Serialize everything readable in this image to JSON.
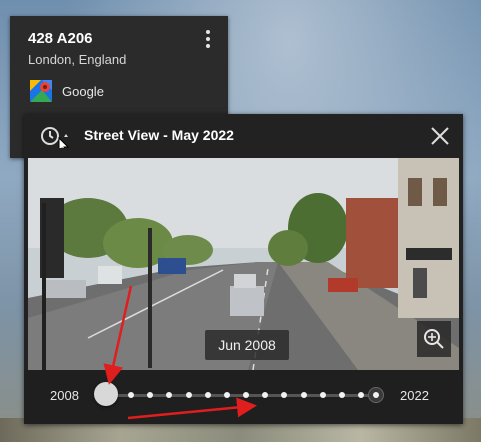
{
  "place": {
    "title": "428 A206",
    "subtitle": "London, England",
    "provider": "Google",
    "provider_icon": "google-maps-icon",
    "menu_icon": "more-vert-icon"
  },
  "streetview": {
    "title": "Street View - May 2022",
    "history_icon": "time-history-icon",
    "close_icon": "close-icon",
    "date_chip": "Jun 2008",
    "zoom_icon": "zoom-in-icon",
    "timeline": {
      "start_label": "2008",
      "end_label": "2022",
      "selected_year": "2008",
      "tick_count": 13
    }
  },
  "annotations": {
    "arrow_color": "#e01e1e"
  }
}
